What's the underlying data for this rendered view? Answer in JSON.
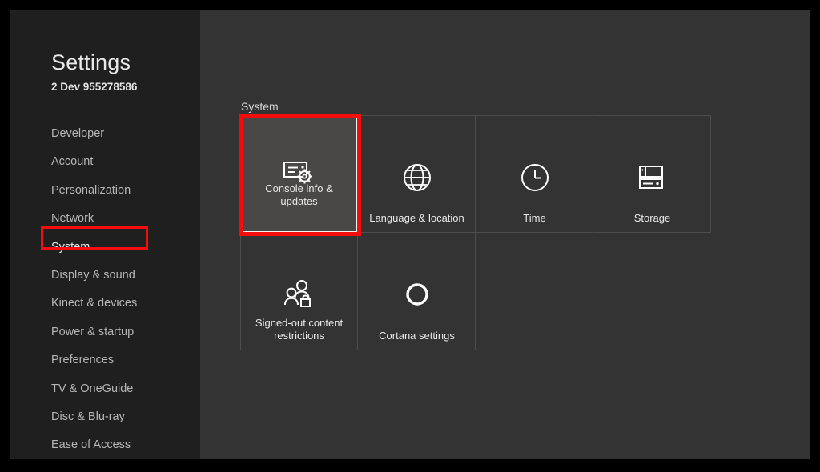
{
  "app": {
    "title": "Settings",
    "subtitle": "2 Dev 955278586"
  },
  "sidebar": {
    "items": [
      {
        "label": "Developer",
        "selected": false
      },
      {
        "label": "Account",
        "selected": false
      },
      {
        "label": "Personalization",
        "selected": false
      },
      {
        "label": "Network",
        "selected": false
      },
      {
        "label": "System",
        "selected": true
      },
      {
        "label": "Display & sound",
        "selected": false
      },
      {
        "label": "Kinect & devices",
        "selected": false
      },
      {
        "label": "Power & startup",
        "selected": false
      },
      {
        "label": "Preferences",
        "selected": false
      },
      {
        "label": "TV & OneGuide",
        "selected": false
      },
      {
        "label": "Disc & Blu-ray",
        "selected": false
      },
      {
        "label": "Ease of Access",
        "selected": false
      }
    ]
  },
  "main": {
    "section_label": "System",
    "tiles_row1": [
      {
        "label": "Console info & updates",
        "icon": "console-info-icon",
        "selected": true
      },
      {
        "label": "Language & location",
        "icon": "globe-icon",
        "selected": false
      },
      {
        "label": "Time",
        "icon": "clock-icon",
        "selected": false
      },
      {
        "label": "Storage",
        "icon": "storage-icon",
        "selected": false
      }
    ],
    "tiles_row2": [
      {
        "label": "Signed-out content restrictions",
        "icon": "people-lock-icon",
        "selected": false
      },
      {
        "label": "Cortana settings",
        "icon": "cortana-ring-icon",
        "selected": false
      }
    ]
  },
  "annotations": {
    "highlight_color": "#f40d0d",
    "nav_highlight_target": "System",
    "tile_highlight_target": "Console info & updates"
  },
  "colors": {
    "sidebar_bg": "#1f1f1f",
    "content_bg": "#333333",
    "selected_tile_bg": "#4a4747",
    "tile_border": "#4d4d4d",
    "text_primary": "#e8e8e8",
    "text_secondary": "#b6b6b6"
  }
}
